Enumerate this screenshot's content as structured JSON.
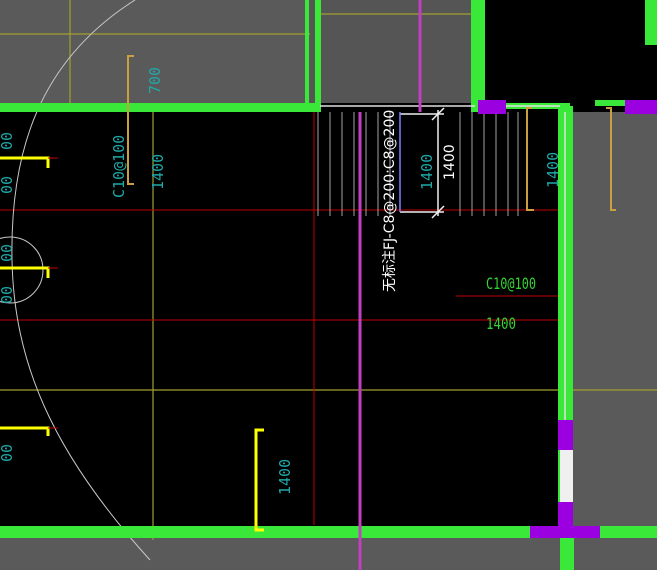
{
  "canvas": {
    "background_color": "#000000",
    "grey_region_color": "#5a5a5a",
    "wall_color": "#3ae83a",
    "magenta_color": "#c040c0",
    "purple_color": "#9a00e0",
    "rebar_yellow": "#ffff00",
    "rebar_orange": "#c8a040",
    "axis_red": "#c00000",
    "grid_olive": "#a0a030",
    "dim_cyan": "#1fa8a8",
    "label_green": "#33d433",
    "arc_grey": "#c8c8c8"
  },
  "labels": {
    "rebar_c10_left": "C10@100",
    "len_1400_a": "1400",
    "len_1400_b": "1400",
    "len_1400_c": "1400",
    "len_1400_d": "1400",
    "len_1400_e": "1400",
    "len_700": "700",
    "rebar_c10_right": "C10@100",
    "len_1400_right": "1400",
    "unmarked_note": "无标注FJ-C8@200:C8@200",
    "left_edge_1": "00",
    "left_edge_2": "00",
    "left_edge_3": "00",
    "left_edge_4": "00",
    "left_edge_5": "00"
  }
}
